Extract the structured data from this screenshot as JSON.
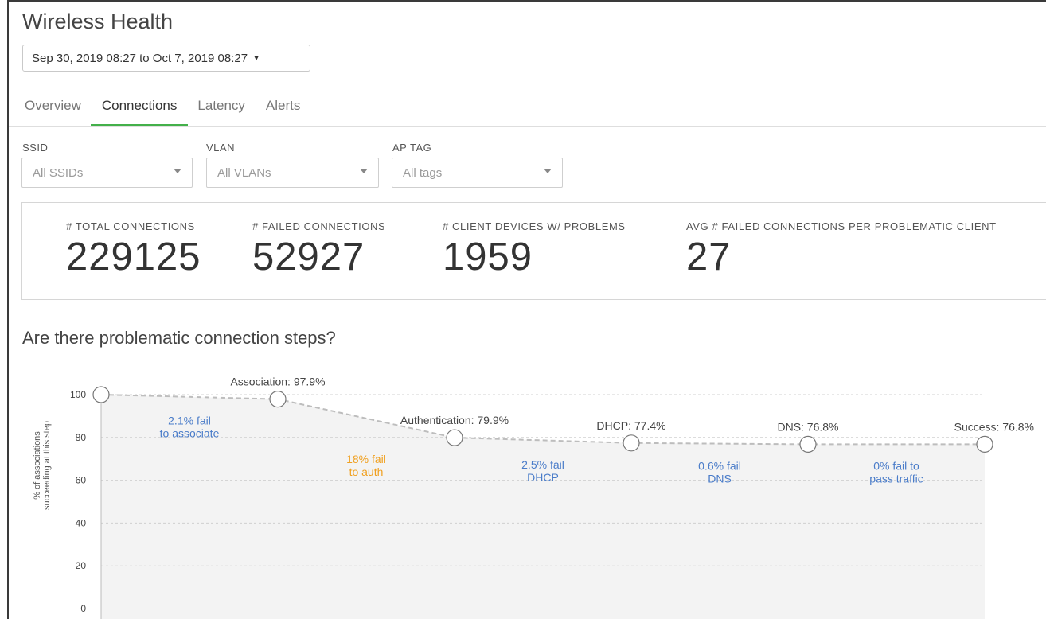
{
  "page": {
    "title": "Wireless Health",
    "date_range": "Sep 30, 2019 08:27 to Oct 7, 2019 08:27"
  },
  "tabs": [
    {
      "label": "Overview",
      "active": false
    },
    {
      "label": "Connections",
      "active": true
    },
    {
      "label": "Latency",
      "active": false
    },
    {
      "label": "Alerts",
      "active": false
    }
  ],
  "filters": {
    "ssid": {
      "label": "SSID",
      "value": "All SSIDs"
    },
    "vlan": {
      "label": "VLAN",
      "value": "All VLANs"
    },
    "ap_tag": {
      "label": "AP TAG",
      "value": "All tags"
    }
  },
  "stats": [
    {
      "label": "# TOTAL CONNECTIONS",
      "value": "229125"
    },
    {
      "label": "# FAILED CONNECTIONS",
      "value": "52927"
    },
    {
      "label": "# CLIENT DEVICES W/ PROBLEMS",
      "value": "1959"
    },
    {
      "label": "AVG # FAILED CONNECTIONS PER PROBLEMATIC CLIENT",
      "value": "27"
    }
  ],
  "section": {
    "title": "Are there problematic connection steps?"
  },
  "colors": {
    "accent": "#43b04a",
    "fail_blue": "#4a7cc9",
    "fail_orange": "#f0a020"
  },
  "chart_data": {
    "type": "line",
    "ylabel": "% of associations succeeding at this step",
    "ylim": [
      0,
      100
    ],
    "yticks": [
      0,
      20,
      40,
      60,
      80,
      100
    ],
    "grid": true,
    "points": [
      {
        "step": "Start",
        "value": 100,
        "label": ""
      },
      {
        "step": "Association",
        "value": 97.9,
        "label": "Association: 97.9%"
      },
      {
        "step": "Authentication",
        "value": 79.9,
        "label": "Authentication: 79.9%"
      },
      {
        "step": "DHCP",
        "value": 77.4,
        "label": "DHCP: 77.4%"
      },
      {
        "step": "DNS",
        "value": 76.8,
        "label": "DNS: 76.8%"
      },
      {
        "step": "Success",
        "value": 76.8,
        "label": "Success: 76.8%"
      }
    ],
    "annotations": [
      {
        "lines": [
          "2.1% fail",
          "to associate"
        ],
        "color": "blue"
      },
      {
        "lines": [
          "18% fail",
          "to auth"
        ],
        "color": "orange"
      },
      {
        "lines": [
          "2.5% fail",
          "DHCP"
        ],
        "color": "blue"
      },
      {
        "lines": [
          "0.6% fail",
          "DNS"
        ],
        "color": "blue"
      },
      {
        "lines": [
          "0% fail to",
          "pass traffic"
        ],
        "color": "blue"
      }
    ]
  }
}
